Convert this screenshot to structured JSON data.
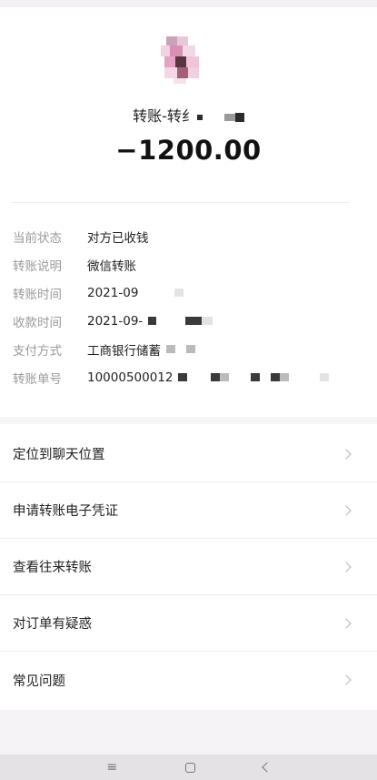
{
  "header": {
    "title": "转账-转纟",
    "amount": "−1200.00"
  },
  "details": [
    {
      "label": "当前状态",
      "value": "对方已收钱"
    },
    {
      "label": "转账说明",
      "value": "微信转账"
    },
    {
      "label": "转账时间",
      "value": "2021-09"
    },
    {
      "label": "收款时间",
      "value": "2021-09-"
    },
    {
      "label": "支付方式",
      "value": "工商银行储蓄"
    },
    {
      "label": "转账单号",
      "value": "10000500012"
    }
  ],
  "menu": [
    {
      "label": "定位到聊天位置"
    },
    {
      "label": "申请转账电子凭证"
    },
    {
      "label": "查看往来转账"
    },
    {
      "label": "对订单有疑惑"
    },
    {
      "label": "常见问题"
    }
  ],
  "navbar": {
    "menu_icon": "menu-icon",
    "home_icon": "home-icon",
    "back_icon": "back-icon",
    "menu_glyph": "≡"
  }
}
